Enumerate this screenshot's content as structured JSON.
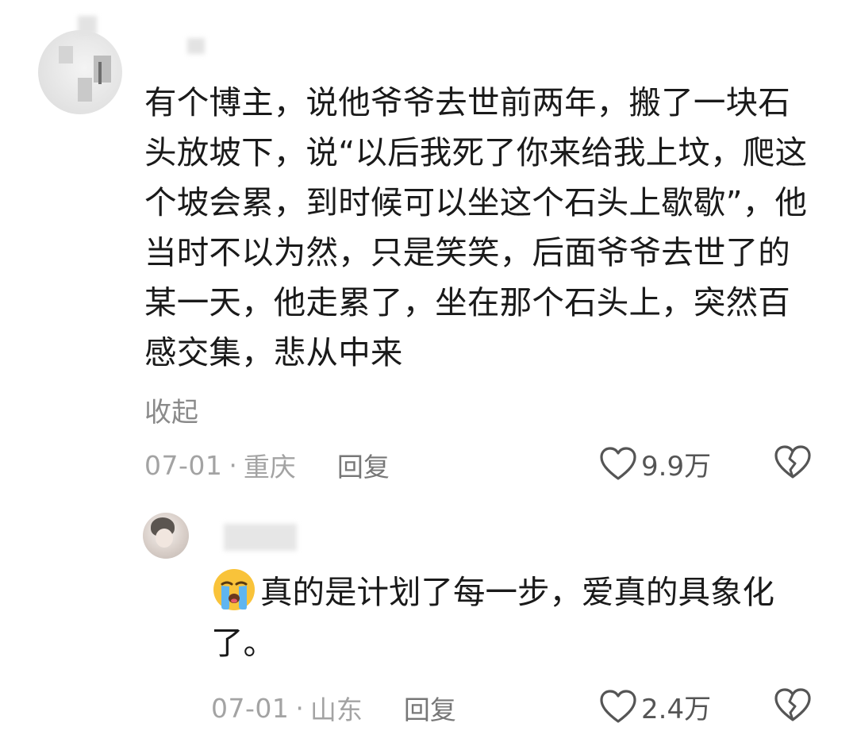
{
  "comment": {
    "text": "有个博主，说他爷爷去世前两年，搬了一块石头放坡下，说“以后我死了你来给我上坟，爬这个坡会累，到时候可以坐这个石头上歇歇”，他当时不以为然，只是笑笑，后面爷爷去世了的某一天，他走累了，坐在那个石头上，突然百感交集，悲从中来",
    "collapse_label": "收起",
    "date": "07-01",
    "separator": "·",
    "location": "重庆",
    "reply_label": "回复",
    "likes": "9.9万"
  },
  "reply": {
    "emoji_icon": "loudly-crying-face-icon",
    "text": "真的是计划了每一步，爱真的具象化了。",
    "date": "07-01",
    "separator": "·",
    "location": "山东",
    "reply_label": "回复",
    "likes": "2.4万"
  },
  "colors": {
    "text_primary": "#1a1a1a",
    "text_meta": "#a3a3a3",
    "text_link": "#8a8a8a",
    "icon_stroke": "#555555"
  }
}
